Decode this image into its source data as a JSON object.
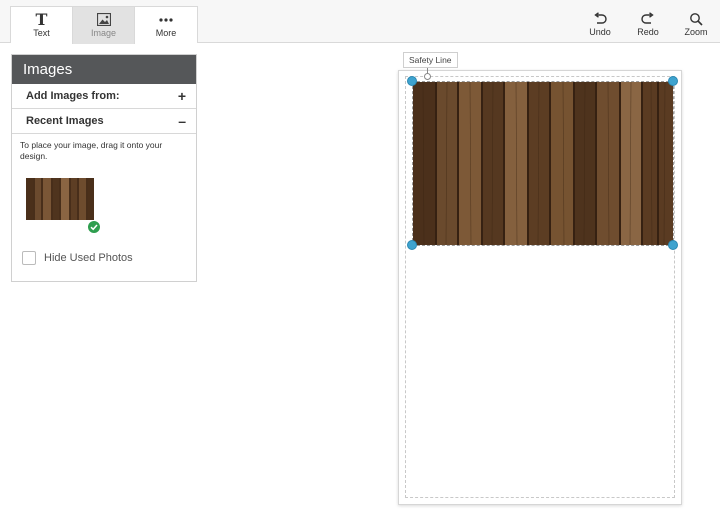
{
  "toolbar": {
    "left_tools": [
      {
        "label": "Text",
        "icon": "text-icon"
      },
      {
        "label": "Image",
        "icon": "image-icon"
      },
      {
        "label": "More",
        "icon": "more-icon"
      }
    ],
    "right_tools": [
      {
        "label": "Undo",
        "icon": "undo-icon"
      },
      {
        "label": "Redo",
        "icon": "redo-icon"
      },
      {
        "label": "Zoom",
        "icon": "zoom-icon"
      }
    ]
  },
  "panel": {
    "title": "Images",
    "add_images_label": "Add Images from:",
    "add_sign": "+",
    "recent_images_label": "Recent Images",
    "recent_sign": "–",
    "hint": "To place your image, drag it onto your design.",
    "hide_used_label": "Hide Used Photos"
  },
  "canvas": {
    "safety_line_label": "Safety Line"
  },
  "colors": {
    "panel_header": "#555759",
    "handle": "#3ea3cf",
    "check": "#2e9e4f",
    "wood_base": "#5a3b22"
  }
}
